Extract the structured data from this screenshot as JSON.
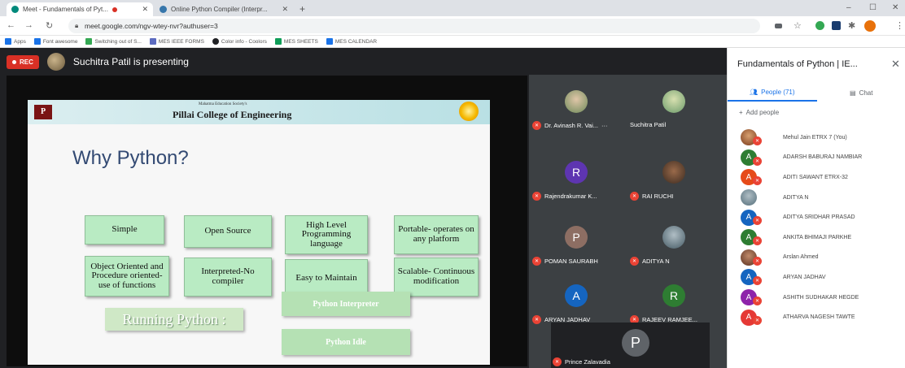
{
  "browser": {
    "tabs": [
      {
        "title": "Meet - Fundamentals of Pyt...",
        "active": true
      },
      {
        "title": "Online Python Compiler (Interpr...",
        "active": false
      }
    ],
    "new_tab": "+",
    "url": "meet.google.com/ngv-wtey-nvr?authuser=3",
    "window_controls": {
      "minimize": "–",
      "maximize": "☐",
      "close": "✕"
    },
    "bookmarks": [
      {
        "label": "Apps",
        "color": "#1a73e8"
      },
      {
        "label": "Font awesome",
        "color": "#1a73e8"
      },
      {
        "label": "Switching out of S...",
        "color": "#34a853"
      },
      {
        "label": "MES IEEE FORMS",
        "color": "#5c6bc0"
      },
      {
        "label": "Color info - Coolors",
        "color": "#202124"
      },
      {
        "label": "MES SHEETS",
        "color": "#0f9d58"
      },
      {
        "label": "MES CALENDAR",
        "color": "#1a73e8"
      }
    ]
  },
  "meet": {
    "rec_label": "REC",
    "presenting_text": "Suchitra Patil is presenting",
    "slide": {
      "college_subtitle": "Mahatma Education Society's",
      "college": "Pillai College of Engineering",
      "title": "Why Python?",
      "topics": [
        "Simple",
        "Open Source",
        "High Level Programming language",
        "Portable- operates on any platform",
        "Object Oriented and Procedure oriented-use of functions",
        "Interpreted-No compiler",
        "Easy to Maintain",
        "Scalable- Continuous modification"
      ],
      "running_label": "Running Python :",
      "interpreter_label": "Python Interpreter",
      "idle_label": "Python Idle"
    },
    "tiles": [
      {
        "name": "Dr. Avinash R. Vai...",
        "initial": "",
        "color": "#8d6e63"
      },
      {
        "name": "Suchitra Patil",
        "initial": "",
        "color": "#9e9e6e"
      },
      {
        "name": "Rajendrakumar K...",
        "initial": "R",
        "color": "#5e35b1"
      },
      {
        "name": "RAI RUCHI",
        "initial": "",
        "color": "#795548"
      },
      {
        "name": "POMAN SAURABH",
        "initial": "P",
        "color": "#8d6e63"
      },
      {
        "name": "ADITYA N",
        "initial": "",
        "color": "#607d8b"
      },
      {
        "name": "ARYAN JADHAV",
        "initial": "A",
        "color": "#1565c0"
      },
      {
        "name": "RAJEEV RAMJEE...",
        "initial": "R",
        "color": "#2e7d32"
      }
    ],
    "more_dots": "···",
    "big_tile": {
      "name": "Prince Zalavadia",
      "initial": "P"
    }
  },
  "panel": {
    "title": "Fundamentals of Python | IE...",
    "close": "✕",
    "people_tab": "People (71)",
    "chat_tab": "Chat",
    "add_people": "Add people",
    "participants": [
      {
        "name": "Mehul Jain ETRX 7 (You)",
        "initial": "",
        "color": "#a0522d"
      },
      {
        "name": "ADARSH BABURAJ NAMBIAR",
        "initial": "A",
        "color": "#2e7d32"
      },
      {
        "name": "ADITI SAWANT ETRX-32",
        "initial": "A",
        "color": "#e64a19"
      },
      {
        "name": "ADITYA N",
        "initial": "",
        "color": "#78909c"
      },
      {
        "name": "ADITYA SRIDHAR PRASAD",
        "initial": "A",
        "color": "#1565c0"
      },
      {
        "name": "ANKITA BHIMAJI PARKHE",
        "initial": "A",
        "color": "#2e7d32"
      },
      {
        "name": "Arslan Ahmed",
        "initial": "",
        "color": "#795548"
      },
      {
        "name": "ARYAN JADHAV",
        "initial": "A",
        "color": "#1565c0"
      },
      {
        "name": "ASHITH SUDHAKAR HEGDE",
        "initial": "A",
        "color": "#8e24aa"
      },
      {
        "name": "ATHARVA NAGESH TAWTE",
        "initial": "A",
        "color": "#e53935"
      }
    ]
  }
}
